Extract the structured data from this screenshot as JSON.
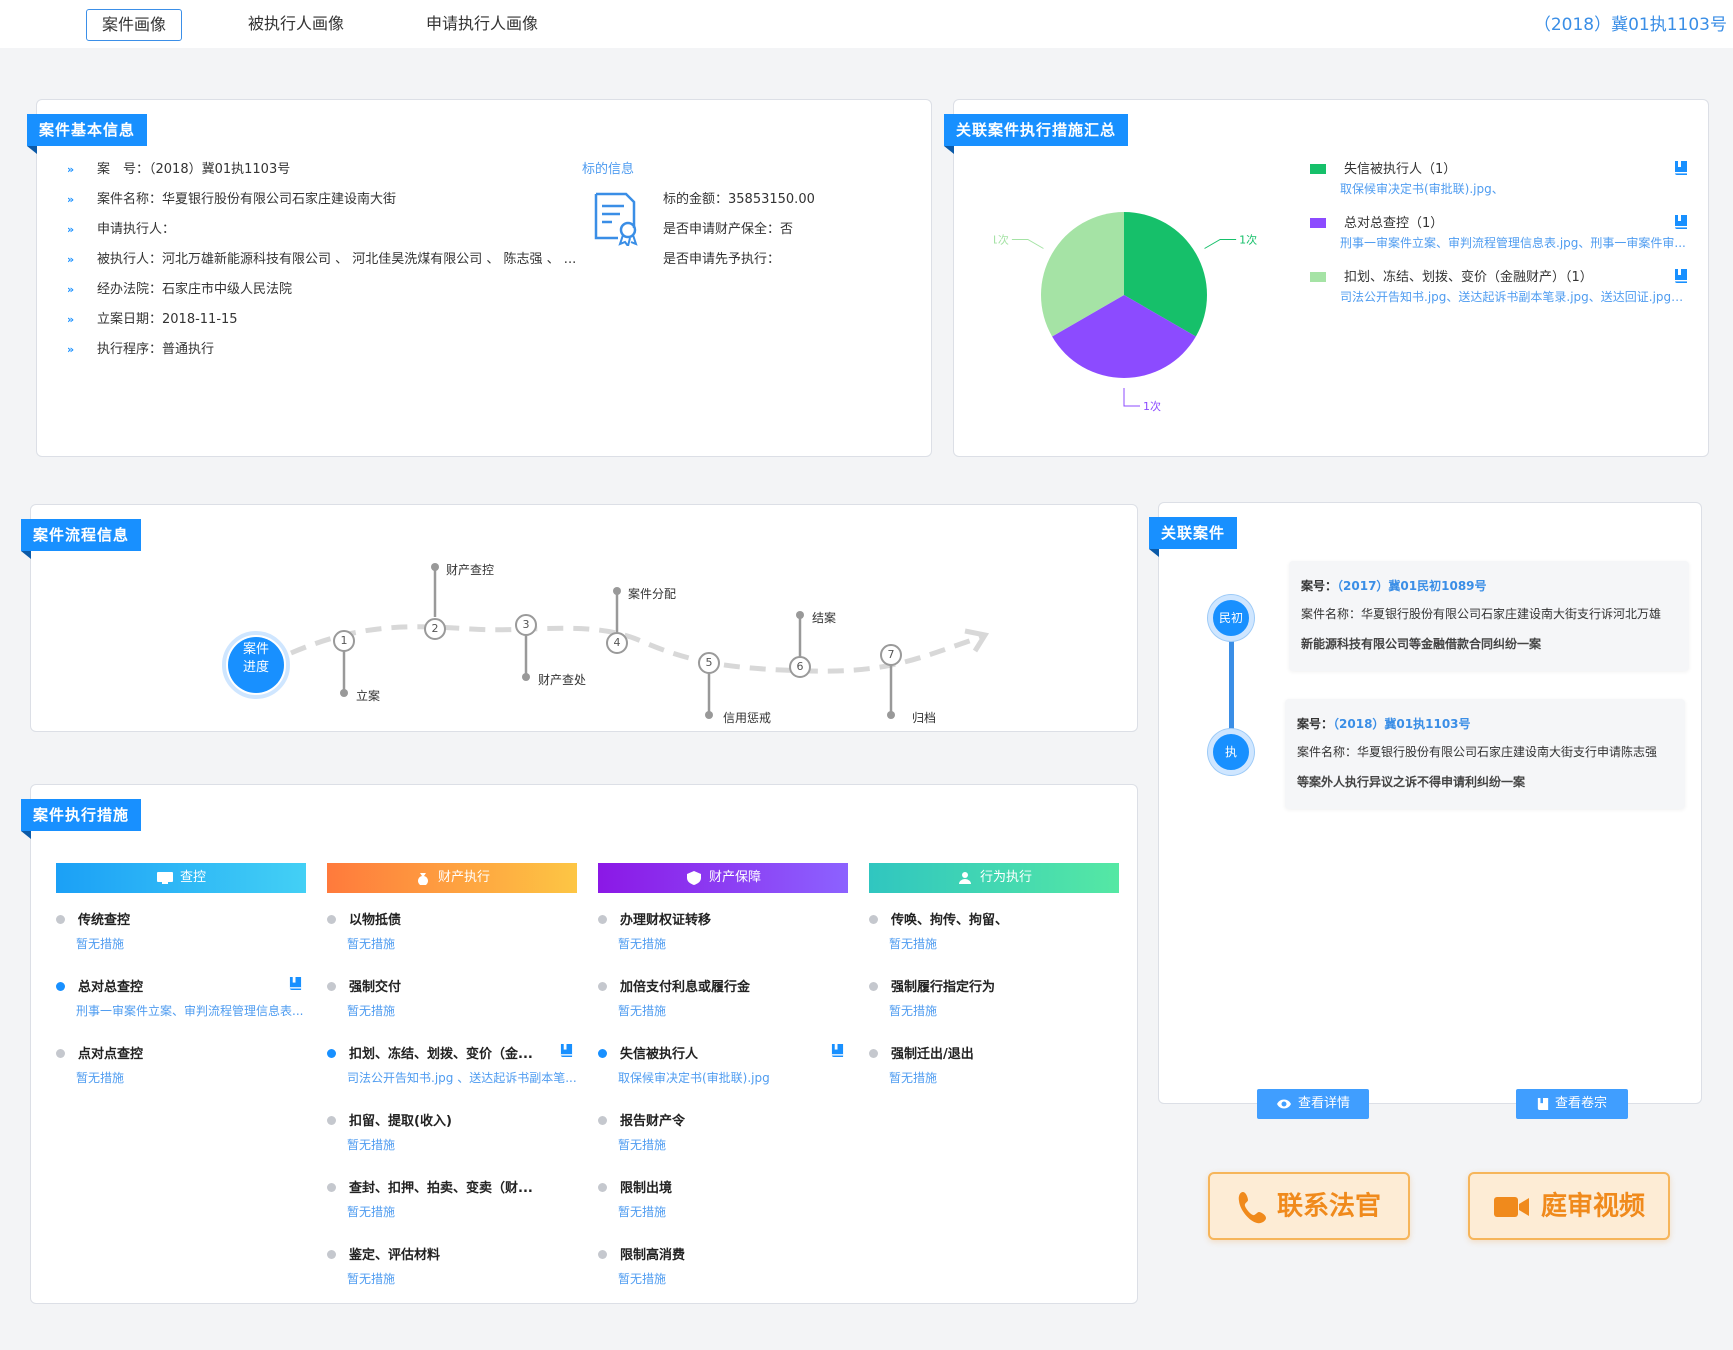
{
  "tabs": [
    {
      "label": "案件画像",
      "active": true
    },
    {
      "label": "被执行人画像",
      "active": false
    },
    {
      "label": "申请执行人画像",
      "active": false
    }
  ],
  "header_case_code": "（2018）冀01执1103号",
  "basic": {
    "title": "案件基本信息",
    "rows": [
      {
        "label": "案　号：",
        "value": "（2018）冀01执1103号"
      },
      {
        "label": "案件名称：",
        "value": "华夏银行股份有限公司石家庄建设南大街"
      },
      {
        "label": "申请执行人：",
        "value": ""
      },
      {
        "label": "被执行人：",
        "value": "河北万雄新能源科技有限公司 、 河北佳昊洗煤有限公司 、 陈志强 、 ..."
      },
      {
        "label": "经办法院：",
        "value": "石家庄市中级人民法院"
      },
      {
        "label": "立案日期：",
        "value": "2018-11-15"
      },
      {
        "label": "执行程序：",
        "value": "普通执行"
      }
    ],
    "target_title": "标的信息",
    "target_rows": [
      {
        "label": "标的金额：",
        "value": "35853150.00"
      },
      {
        "label": "是否申请财产保全：",
        "value": "否"
      },
      {
        "label": "是否申请先予执行：",
        "value": ""
      }
    ]
  },
  "summary": {
    "title": "关联案件执行措施汇总",
    "pie_labels": [
      "1次",
      "1次",
      "1次"
    ],
    "legend": [
      {
        "title": "失信被执行人（1）",
        "files": "取保候审决定书(审批联).jpg、",
        "color": "#16c06a"
      },
      {
        "title": "总对总查控（1）",
        "files": "刑事一审案件立案、审判流程管理信息表.jpg、刑事一审案件审...",
        "color": "#8c4bff"
      },
      {
        "title": "扣划、冻结、划拨、变价（金融财产）（1）",
        "files": "司法公开告知书.jpg、送达起诉书副本笔录.jpg、送达回证.jpg、...",
        "color": "#a5e3a5"
      }
    ],
    "chart_data": {
      "type": "pie",
      "categories": [
        "失信被执行人",
        "总对总查控",
        "扣划、冻结、划拨、变价（金融财产）"
      ],
      "values": [
        1,
        1,
        1
      ],
      "colors": [
        "#16c06a",
        "#8c4bff",
        "#a5e3a5"
      ],
      "data_labels": [
        "1次",
        "1次",
        "1次"
      ]
    }
  },
  "process": {
    "title": "案件流程信息",
    "start_label_1": "案件",
    "start_label_2": "进度",
    "steps": [
      {
        "num": "1",
        "label": "立案"
      },
      {
        "num": "2",
        "label": "财产查控"
      },
      {
        "num": "3",
        "label": "财产查处"
      },
      {
        "num": "4",
        "label": "案件分配"
      },
      {
        "num": "5",
        "label": "信用惩戒"
      },
      {
        "num": "6",
        "label": "结案"
      },
      {
        "num": "7",
        "label": "归档"
      }
    ]
  },
  "measures": {
    "title": "案件执行措施",
    "columns": [
      {
        "header": "查控",
        "items": [
          {
            "name": "传统查控",
            "sub": "暂无措施",
            "active": false,
            "book": false
          },
          {
            "name": "总对总查控",
            "sub": "刑事一审案件立案、审判流程管理信息表...",
            "active": true,
            "book": true
          },
          {
            "name": "点对点查控",
            "sub": "暂无措施",
            "active": false,
            "book": false
          }
        ]
      },
      {
        "header": "财产执行",
        "items": [
          {
            "name": "以物抵债",
            "sub": "暂无措施",
            "active": false,
            "book": false
          },
          {
            "name": "强制交付",
            "sub": "暂无措施",
            "active": false,
            "book": false
          },
          {
            "name": "扣划、冻结、划拨、变价（金...",
            "sub": "司法公开告知书.jpg 、送达起诉书副本笔...",
            "active": true,
            "book": true
          },
          {
            "name": "扣留、提取(收入)",
            "sub": "暂无措施",
            "active": false,
            "book": false
          },
          {
            "name": "查封、扣押、拍卖、变卖（财...",
            "sub": "暂无措施",
            "active": false,
            "book": false
          },
          {
            "name": "鉴定、评估材料",
            "sub": "暂无措施",
            "active": false,
            "book": false
          }
        ]
      },
      {
        "header": "财产保障",
        "items": [
          {
            "name": "办理财权证转移",
            "sub": "暂无措施",
            "active": false,
            "book": false
          },
          {
            "name": "加倍支付利息或履行金",
            "sub": "暂无措施",
            "active": false,
            "book": false
          },
          {
            "name": "失信被执行人",
            "sub": "取保候审决定书(审批联).jpg",
            "active": true,
            "book": true
          },
          {
            "name": "报告财产令",
            "sub": "暂无措施",
            "active": false,
            "book": false
          },
          {
            "name": "限制出境",
            "sub": "暂无措施",
            "active": false,
            "book": false
          },
          {
            "name": "限制高消费",
            "sub": "暂无措施",
            "active": false,
            "book": false
          }
        ]
      },
      {
        "header": "行为执行",
        "items": [
          {
            "name": "传唤、拘传、拘留、",
            "sub": "暂无措施",
            "active": false,
            "book": false
          },
          {
            "name": "强制履行指定行为",
            "sub": "暂无措施",
            "active": false,
            "book": false
          },
          {
            "name": "强制迁出/退出",
            "sub": "暂无措施",
            "active": false,
            "book": false
          }
        ]
      }
    ]
  },
  "related": {
    "title": "关联案件",
    "cases": [
      {
        "badge": "民初",
        "no_label": "案号：",
        "no": "（2017）冀01民初1089号",
        "name_label": "案件名称：",
        "name": "华夏银行股份有限公司石家庄建设南大街支行诉河北万雄",
        "extra": "新能源科技有限公司等金融借款合同纠纷一案"
      },
      {
        "badge": "执",
        "no_label": "案号：",
        "no": "（2018）冀01执1103号",
        "name_label": "案件名称：",
        "name": "华夏银行股份有限公司石家庄建设南大街支行申请陈志强",
        "extra": "等案外人执行异议之诉不得申请利纠纷一案"
      }
    ],
    "detail_btn": "查看详情",
    "file_btn": "查看卷宗"
  },
  "actions": {
    "contact": "联系法官",
    "video": "庭审视频"
  }
}
